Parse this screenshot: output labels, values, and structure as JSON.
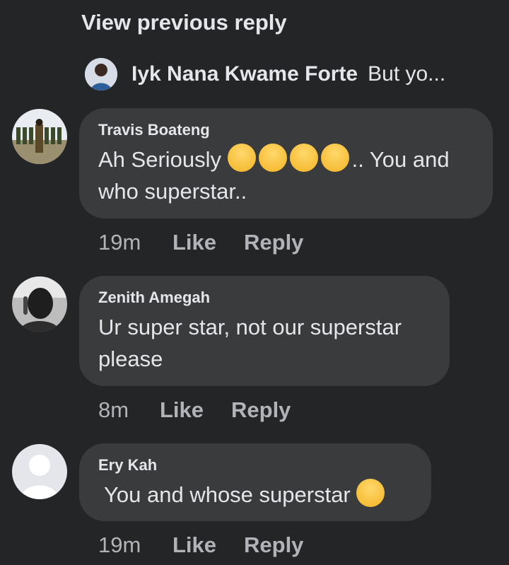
{
  "view_previous": "View previous reply",
  "reply_preview": {
    "name": "Iyk Nana Kwame Forte",
    "text": "But yo..."
  },
  "comments": [
    {
      "author": "Travis Boateng",
      "text_before": "Ah Seriously ",
      "emoji": "laughing-crying-emoji",
      "emoji_count": 4,
      "text_after": "..  You and who superstar..",
      "time": "19m",
      "like": "Like",
      "reply": "Reply"
    },
    {
      "author": "Zenith Amegah",
      "text": "Ur super star, not our superstar please",
      "time": "8m",
      "like": "Like",
      "reply": "Reply"
    },
    {
      "author": "Ery Kah",
      "text": " You and whose superstar ",
      "emoji": "eye-roll-emoji",
      "time": "19m",
      "like": "Like",
      "reply": "Reply"
    }
  ],
  "colors": {
    "background": "#242526",
    "bubble": "#3a3b3c",
    "text": "#e4e6eb",
    "meta": "#b0b3b8",
    "emoji": "#f7c948"
  }
}
